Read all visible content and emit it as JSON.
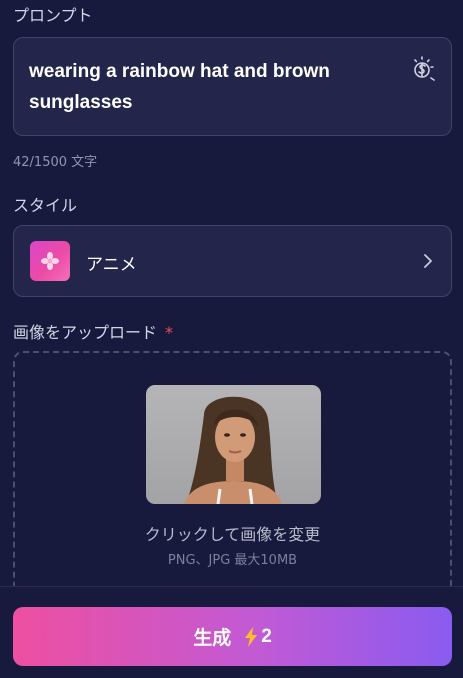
{
  "prompt": {
    "label": "プロンプト",
    "text": "wearing a rainbow hat and brown sunglasses",
    "char_count": "42/1500 文字",
    "magic_icon": "sparkle-brush-icon"
  },
  "style": {
    "label": "スタイル",
    "selected": "アニメ",
    "thumb_icon": "flower-icon"
  },
  "upload": {
    "label": "画像をアップロード",
    "required_mark": "*",
    "hint": "クリックして画像を変更",
    "formats": "PNG、JPG 最大10MB"
  },
  "generate": {
    "label": "生成",
    "cost": "2",
    "cost_icon": "bolt-icon"
  },
  "colors": {
    "background": "#171a3d",
    "panel": "#23264a",
    "accent_start": "#ee4fa0",
    "accent_end": "#8a5bf0",
    "required": "#f04b5c",
    "bolt": "#fbbf24"
  }
}
